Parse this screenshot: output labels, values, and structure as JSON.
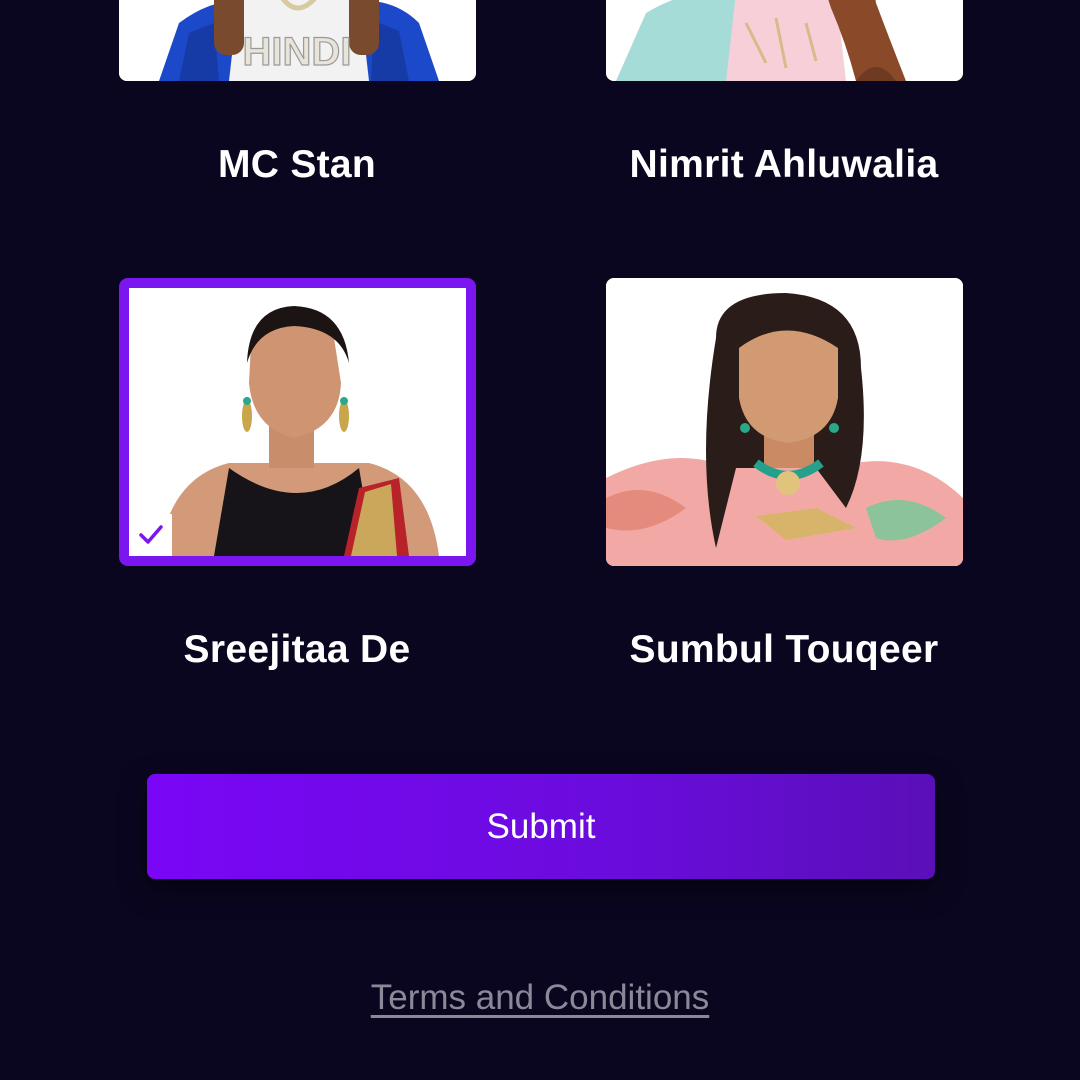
{
  "contestants": [
    {
      "name": "MC Stan",
      "photo_icon": "contestant-photo-mc-stan",
      "photo_caption": "HINDI",
      "selected": false
    },
    {
      "name": "Nimrit Ahluwalia",
      "photo_icon": "contestant-photo-nimrit",
      "selected": false
    },
    {
      "name": "Sreejitaa De",
      "photo_icon": "contestant-photo-sreejitaa",
      "selected": true
    },
    {
      "name": "Sumbul Touqeer",
      "photo_icon": "contestant-photo-sumbul",
      "selected": false
    }
  ],
  "submit_label": "Submit",
  "terms_label": "Terms and Conditions",
  "colors": {
    "background": "#0b0620",
    "accent": "#7c16f0",
    "terms_text": "#8c8898"
  }
}
